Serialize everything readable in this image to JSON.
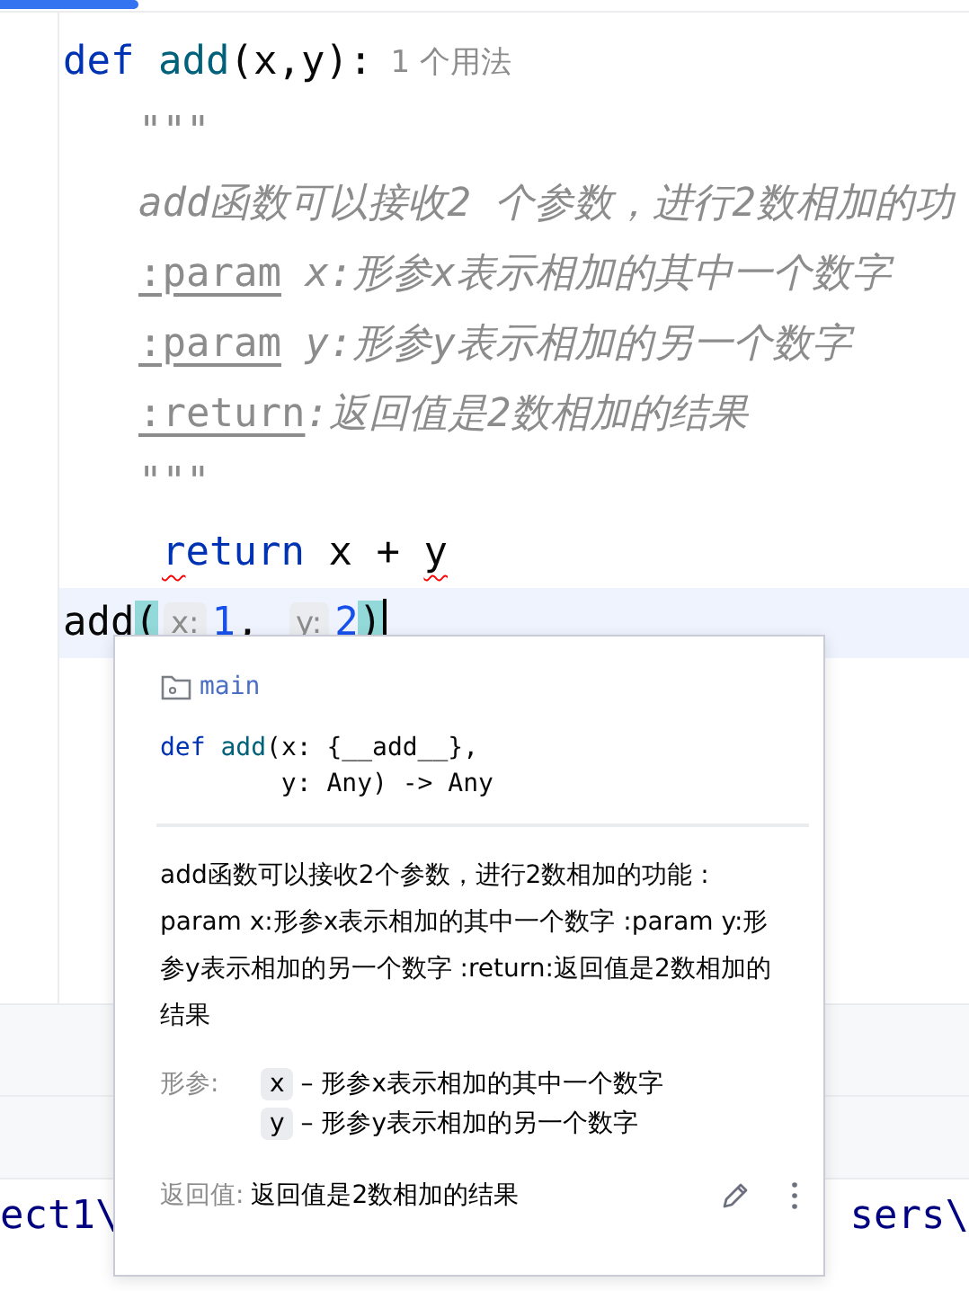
{
  "editor": {
    "lines": [
      {
        "kind": "code",
        "current": false,
        "caret": false,
        "runs": [
          {
            "kind": "code",
            "parts": [
              {
                "text": "def ",
                "kind": "keyword"
              },
              {
                "text": "add",
                "kind": "function"
              },
              {
                "text": "(x,y):",
                "kind": "plain"
              }
            ]
          },
          {
            "kind": "inlay",
            "text": "1 个用法"
          }
        ]
      },
      {
        "kind": "doc",
        "current": false,
        "caret": false,
        "runs": [
          {
            "kind": "code",
            "parts": [
              {
                "text": "\"\"\"",
                "kind": "doc"
              }
            ]
          }
        ]
      },
      {
        "kind": "doc",
        "current": false,
        "caret": false,
        "runs": [
          {
            "kind": "code",
            "parts": [
              {
                "text": "add函数可以接收2 个参数，进行2数相加的功",
                "kind": "doc"
              }
            ]
          }
        ]
      },
      {
        "kind": "doc",
        "current": false,
        "caret": false,
        "runs": [
          {
            "kind": "code",
            "parts": [
              {
                "text": ":param",
                "kind": "doctag"
              },
              {
                "text": " x:形参x表示相加的其中一个数字",
                "kind": "doc"
              }
            ]
          }
        ]
      },
      {
        "kind": "doc",
        "current": false,
        "caret": false,
        "runs": [
          {
            "kind": "code",
            "parts": [
              {
                "text": ":param",
                "kind": "doctag"
              },
              {
                "text": " y:形参y表示相加的另一个数字",
                "kind": "doc"
              }
            ]
          }
        ]
      },
      {
        "kind": "doc",
        "current": false,
        "caret": false,
        "runs": [
          {
            "kind": "code",
            "parts": [
              {
                "text": ":return",
                "kind": "doctag"
              },
              {
                "text": ":返回值是2数相加的结果",
                "kind": "doc"
              }
            ]
          }
        ]
      },
      {
        "kind": "doc",
        "current": false,
        "caret": false,
        "runs": [
          {
            "kind": "code",
            "parts": [
              {
                "text": "\"\"\"",
                "kind": "doc"
              }
            ]
          }
        ]
      },
      {
        "kind": "body",
        "current": false,
        "caret": false,
        "runs": [
          {
            "kind": "code",
            "parts": [
              {
                "text": "r",
                "kind": "keyword",
                "squiggle": true
              },
              {
                "text": "eturn",
                "kind": "keyword"
              },
              {
                "text": " x + ",
                "kind": "plain"
              },
              {
                "text": "y",
                "kind": "plain",
                "squiggle": true
              }
            ]
          }
        ]
      },
      {
        "kind": "code",
        "current": true,
        "caret": true,
        "runs": [
          {
            "kind": "code",
            "parts": [
              {
                "text": "add",
                "kind": "plain"
              },
              {
                "text": "(",
                "kind": "match"
              }
            ]
          },
          {
            "kind": "inlay",
            "text": "x:"
          },
          {
            "kind": "code",
            "parts": [
              {
                "text": "1",
                "kind": "number"
              },
              {
                "text": ", ",
                "kind": "plain"
              }
            ]
          },
          {
            "kind": "inlay",
            "text": "y:"
          },
          {
            "kind": "code",
            "parts": [
              {
                "text": "2",
                "kind": "number"
              },
              {
                "text": ")",
                "kind": "match"
              }
            ]
          }
        ]
      }
    ]
  },
  "popup": {
    "module": "main",
    "signature": [
      [
        {
          "text": "def ",
          "kind": "keyword"
        },
        {
          "text": "add",
          "kind": "function"
        },
        {
          "text": "(x: {__add__},",
          "kind": "plain"
        }
      ],
      [
        {
          "text": "        y: Any) -> Any",
          "kind": "plain"
        }
      ]
    ],
    "description": "add函数可以接收2个参数，进行2数相加的功能 : param x:形参x表示相加的其中一个数字 :param y:形参y表示相加的另一个数字 :return:返回值是2数相加的结果",
    "params_label": "形参:",
    "params": [
      {
        "name": "x",
        "text": "– 形参x表示相加的其中一个数字"
      },
      {
        "name": "y",
        "text": "– 形参y表示相加的另一个数字"
      }
    ],
    "returns_label": "返回值:",
    "returns": "返回值是2数相加的结果"
  },
  "console": {
    "left": "ect1\\",
    "right": "sers\\"
  }
}
